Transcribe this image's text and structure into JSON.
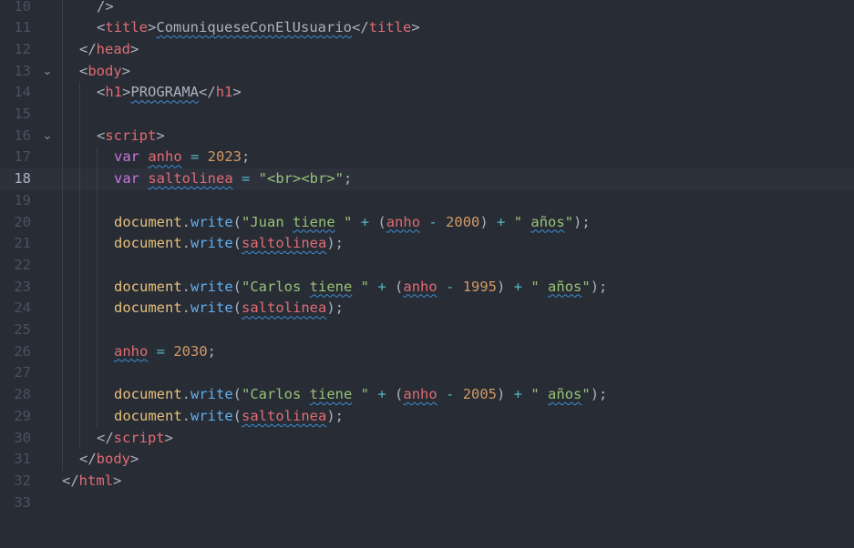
{
  "editor": {
    "active_line": 18,
    "folded_lines": [
      13,
      16
    ],
    "lines": [
      {
        "n": "10",
        "indent": 2,
        "tokens": [
          {
            "t": "/>",
            "c": "punc"
          }
        ]
      },
      {
        "n": "11",
        "indent": 2,
        "tokens": [
          {
            "t": "<",
            "c": "punc"
          },
          {
            "t": "title",
            "c": "tag"
          },
          {
            "t": ">",
            "c": "punc"
          },
          {
            "t": "ComuniqueseConElUsuario",
            "c": "plain",
            "sq": true
          },
          {
            "t": "</",
            "c": "punc"
          },
          {
            "t": "title",
            "c": "tag"
          },
          {
            "t": ">",
            "c": "punc"
          }
        ]
      },
      {
        "n": "12",
        "indent": 1,
        "tokens": [
          {
            "t": "</",
            "c": "punc"
          },
          {
            "t": "head",
            "c": "tag"
          },
          {
            "t": ">",
            "c": "punc"
          }
        ]
      },
      {
        "n": "13",
        "indent": 1,
        "fold": "⌄",
        "tokens": [
          {
            "t": "<",
            "c": "punc"
          },
          {
            "t": "body",
            "c": "tag"
          },
          {
            "t": ">",
            "c": "punc"
          }
        ]
      },
      {
        "n": "14",
        "indent": 2,
        "tokens": [
          {
            "t": "<",
            "c": "punc"
          },
          {
            "t": "h1",
            "c": "tag"
          },
          {
            "t": ">",
            "c": "punc"
          },
          {
            "t": "PROGRAMA",
            "c": "plain",
            "sq": true
          },
          {
            "t": "</",
            "c": "punc"
          },
          {
            "t": "h1",
            "c": "tag"
          },
          {
            "t": ">",
            "c": "punc"
          }
        ]
      },
      {
        "n": "15",
        "indent": 0,
        "tokens": []
      },
      {
        "n": "16",
        "indent": 2,
        "fold": "⌄",
        "tokens": [
          {
            "t": "<",
            "c": "punc"
          },
          {
            "t": "script",
            "c": "tag"
          },
          {
            "t": ">",
            "c": "punc"
          }
        ]
      },
      {
        "n": "17",
        "indent": 3,
        "tokens": [
          {
            "t": "var ",
            "c": "kw"
          },
          {
            "t": "anho",
            "c": "var",
            "sq": true
          },
          {
            "t": " = ",
            "c": "op"
          },
          {
            "t": "2023",
            "c": "num"
          },
          {
            "t": ";",
            "c": "punc"
          }
        ]
      },
      {
        "n": "18",
        "indent": 3,
        "tokens": [
          {
            "t": "var ",
            "c": "kw"
          },
          {
            "t": "saltolinea",
            "c": "var",
            "sq": true
          },
          {
            "t": " = ",
            "c": "op"
          },
          {
            "t": "\"<br><br>\"",
            "c": "str"
          },
          {
            "t": ";",
            "c": "punc"
          }
        ]
      },
      {
        "n": "19",
        "indent": 0,
        "tokens": []
      },
      {
        "n": "20",
        "indent": 3,
        "tokens": [
          {
            "t": "document",
            "c": "obj"
          },
          {
            "t": ".",
            "c": "punc"
          },
          {
            "t": "write",
            "c": "fn"
          },
          {
            "t": "(",
            "c": "punc"
          },
          {
            "t": "\"Juan ",
            "c": "str"
          },
          {
            "t": "tiene",
            "c": "str",
            "sq": true
          },
          {
            "t": " \"",
            "c": "str"
          },
          {
            "t": " + ",
            "c": "op"
          },
          {
            "t": "(",
            "c": "punc"
          },
          {
            "t": "anho",
            "c": "var",
            "sq": true
          },
          {
            "t": " - ",
            "c": "op"
          },
          {
            "t": "2000",
            "c": "num"
          },
          {
            "t": ")",
            "c": "punc"
          },
          {
            "t": " + ",
            "c": "op"
          },
          {
            "t": "\" ",
            "c": "str"
          },
          {
            "t": "años",
            "c": "str",
            "sq": true
          },
          {
            "t": "\"",
            "c": "str"
          },
          {
            "t": ");",
            "c": "punc"
          }
        ]
      },
      {
        "n": "21",
        "indent": 3,
        "tokens": [
          {
            "t": "document",
            "c": "obj"
          },
          {
            "t": ".",
            "c": "punc"
          },
          {
            "t": "write",
            "c": "fn"
          },
          {
            "t": "(",
            "c": "punc"
          },
          {
            "t": "saltolinea",
            "c": "var",
            "sq": true
          },
          {
            "t": ");",
            "c": "punc"
          }
        ]
      },
      {
        "n": "22",
        "indent": 0,
        "tokens": []
      },
      {
        "n": "23",
        "indent": 3,
        "tokens": [
          {
            "t": "document",
            "c": "obj"
          },
          {
            "t": ".",
            "c": "punc"
          },
          {
            "t": "write",
            "c": "fn"
          },
          {
            "t": "(",
            "c": "punc"
          },
          {
            "t": "\"Carlos ",
            "c": "str"
          },
          {
            "t": "tiene",
            "c": "str",
            "sq": true
          },
          {
            "t": " \"",
            "c": "str"
          },
          {
            "t": " + ",
            "c": "op"
          },
          {
            "t": "(",
            "c": "punc"
          },
          {
            "t": "anho",
            "c": "var",
            "sq": true
          },
          {
            "t": " - ",
            "c": "op"
          },
          {
            "t": "1995",
            "c": "num"
          },
          {
            "t": ")",
            "c": "punc"
          },
          {
            "t": " + ",
            "c": "op"
          },
          {
            "t": "\" ",
            "c": "str"
          },
          {
            "t": "años",
            "c": "str",
            "sq": true
          },
          {
            "t": "\"",
            "c": "str"
          },
          {
            "t": ");",
            "c": "punc"
          }
        ]
      },
      {
        "n": "24",
        "indent": 3,
        "tokens": [
          {
            "t": "document",
            "c": "obj"
          },
          {
            "t": ".",
            "c": "punc"
          },
          {
            "t": "write",
            "c": "fn"
          },
          {
            "t": "(",
            "c": "punc"
          },
          {
            "t": "saltolinea",
            "c": "var",
            "sq": true
          },
          {
            "t": ");",
            "c": "punc"
          }
        ]
      },
      {
        "n": "25",
        "indent": 0,
        "tokens": []
      },
      {
        "n": "26",
        "indent": 3,
        "tokens": [
          {
            "t": "anho",
            "c": "var",
            "sq": true
          },
          {
            "t": " = ",
            "c": "op"
          },
          {
            "t": "2030",
            "c": "num"
          },
          {
            "t": ";",
            "c": "punc"
          }
        ]
      },
      {
        "n": "27",
        "indent": 0,
        "tokens": []
      },
      {
        "n": "28",
        "indent": 3,
        "tokens": [
          {
            "t": "document",
            "c": "obj"
          },
          {
            "t": ".",
            "c": "punc"
          },
          {
            "t": "write",
            "c": "fn"
          },
          {
            "t": "(",
            "c": "punc"
          },
          {
            "t": "\"Carlos ",
            "c": "str"
          },
          {
            "t": "tiene",
            "c": "str",
            "sq": true
          },
          {
            "t": " \"",
            "c": "str"
          },
          {
            "t": " + ",
            "c": "op"
          },
          {
            "t": "(",
            "c": "punc"
          },
          {
            "t": "anho",
            "c": "var",
            "sq": true
          },
          {
            "t": " - ",
            "c": "op"
          },
          {
            "t": "2005",
            "c": "num"
          },
          {
            "t": ")",
            "c": "punc"
          },
          {
            "t": " + ",
            "c": "op"
          },
          {
            "t": "\" ",
            "c": "str"
          },
          {
            "t": "años",
            "c": "str",
            "sq": true
          },
          {
            "t": "\"",
            "c": "str"
          },
          {
            "t": ");",
            "c": "punc"
          }
        ]
      },
      {
        "n": "29",
        "indent": 3,
        "tokens": [
          {
            "t": "document",
            "c": "obj"
          },
          {
            "t": ".",
            "c": "punc"
          },
          {
            "t": "write",
            "c": "fn"
          },
          {
            "t": "(",
            "c": "punc"
          },
          {
            "t": "saltolinea",
            "c": "var",
            "sq": true
          },
          {
            "t": ");",
            "c": "punc"
          }
        ]
      },
      {
        "n": "30",
        "indent": 2,
        "tokens": [
          {
            "t": "</",
            "c": "punc"
          },
          {
            "t": "script",
            "c": "tag"
          },
          {
            "t": ">",
            "c": "punc"
          }
        ]
      },
      {
        "n": "31",
        "indent": 1,
        "tokens": [
          {
            "t": "</",
            "c": "punc"
          },
          {
            "t": "body",
            "c": "tag"
          },
          {
            "t": ">",
            "c": "punc"
          }
        ]
      },
      {
        "n": "32",
        "indent": 0,
        "tokens": [
          {
            "t": "</",
            "c": "punc"
          },
          {
            "t": "html",
            "c": "tag"
          },
          {
            "t": ">",
            "c": "punc"
          }
        ]
      },
      {
        "n": "33",
        "indent": 0,
        "tokens": []
      }
    ]
  }
}
